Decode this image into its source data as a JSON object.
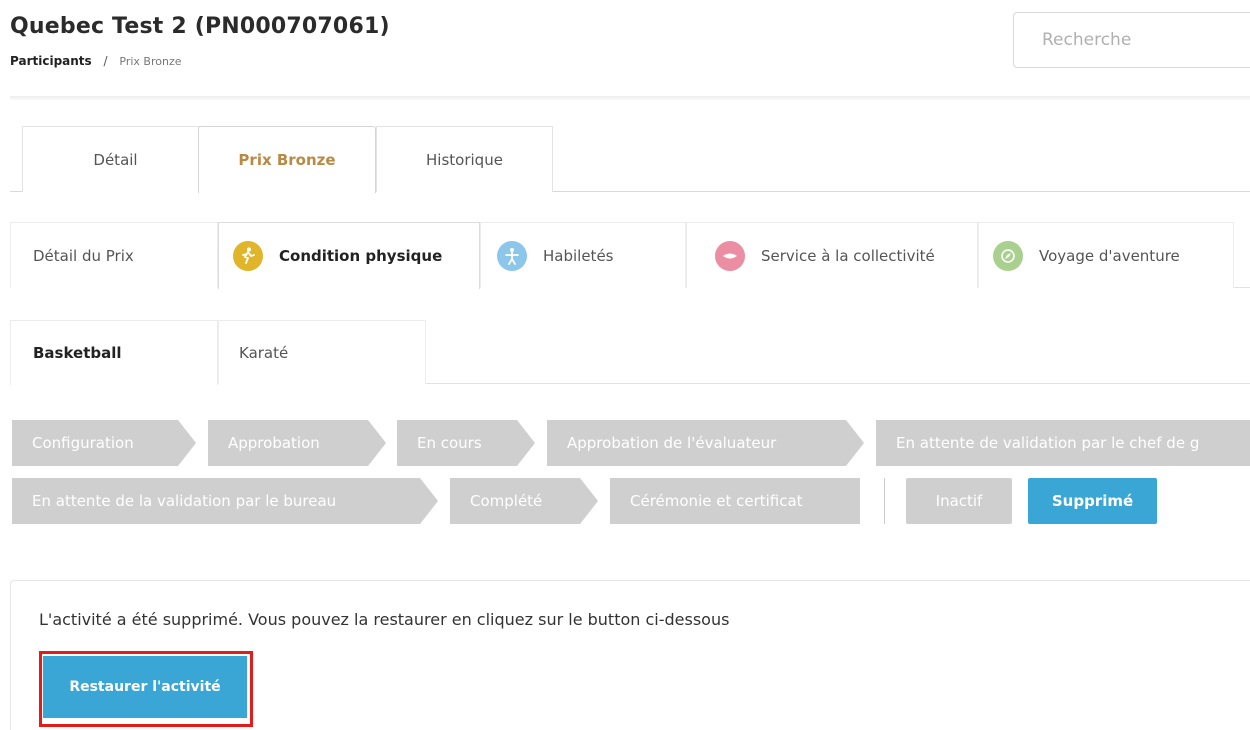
{
  "header": {
    "title": "Quebec Test 2 (PN000707061)",
    "breadcrumb": {
      "parent": "Participants",
      "separator": "/",
      "current": "Prix Bronze"
    },
    "search_placeholder": "Recherche"
  },
  "main_tabs": [
    {
      "label": "Détail",
      "active": false
    },
    {
      "label": "Prix Bronze",
      "active": true
    },
    {
      "label": "Historique",
      "active": false
    }
  ],
  "section_tabs": [
    {
      "label": "Détail du Prix",
      "icon": null,
      "active": false
    },
    {
      "label": "Condition physique",
      "icon": "running-person-icon",
      "icon_color": "#e0b52a",
      "active": true
    },
    {
      "label": "Habiletés",
      "icon": "person-skills-icon",
      "icon_color": "#8cc6ea",
      "active": false
    },
    {
      "label": "Service à la collectivité",
      "icon": "handshake-icon",
      "icon_color": "#ec8ea3",
      "active": false
    },
    {
      "label": "Voyage d'aventure",
      "icon": "compass-icon",
      "icon_color": "#a9d08e",
      "active": false
    }
  ],
  "activity_tabs": [
    {
      "label": "Basketball",
      "active": true
    },
    {
      "label": "Karaté",
      "active": false
    }
  ],
  "status_steps": [
    {
      "label": "Configuration",
      "active": false
    },
    {
      "label": "Approbation",
      "active": false
    },
    {
      "label": "En cours",
      "active": false
    },
    {
      "label": "Approbation de l'évaluateur",
      "active": false
    },
    {
      "label": "En attente de validation par le chef de g",
      "active": false
    },
    {
      "label": "En attente de la validation par le bureau",
      "active": false
    },
    {
      "label": "Complété",
      "active": false
    },
    {
      "label": "Cérémonie et certificat",
      "active": false
    },
    {
      "label": "Inactif",
      "active": false
    },
    {
      "label": "Supprimé",
      "active": true
    }
  ],
  "colors": {
    "accent": "#3aa6d6",
    "step_inactive": "#cfcfcf",
    "active_main_tab": "#b98a45",
    "highlight": "#e21b1b"
  },
  "deleted_panel": {
    "message": "L'activité a été supprimé. Vous pouvez la restaurer en cliquez sur le button ci-dessous",
    "restore_label": "Restaurer l'activité"
  }
}
